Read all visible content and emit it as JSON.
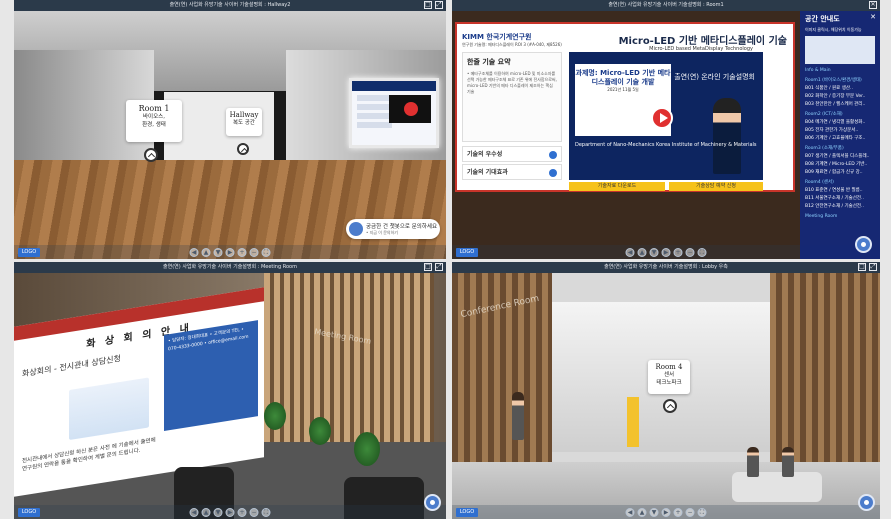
{
  "panes": {
    "hallway": {
      "title": "출연(연) 사업화 유망기술 사이버 기술설명회 : Hallway2",
      "room1": {
        "title": "Room 1",
        "lines": [
          "바이오스,",
          "환경, 생태"
        ]
      },
      "hallway": {
        "title": "Hallway",
        "line": "복도 공간"
      },
      "chat": {
        "main": "궁금한 건 챗봇으로 문의하세요",
        "sub": "• 지금 이 문의하기"
      },
      "logo": "LOGO"
    },
    "room1": {
      "title": "출연(연) 사업화 유망기술 사이버 기술설명회 : Room1",
      "org_logo": "KIMM 한국기계연구원",
      "org_info": "연구원 기술명: 메타디스플레이 ROI 3 (#A-040, 제8526)",
      "main_title": "Micro-LED 기반 메타디스플레이 기술",
      "sub_title": "Micro-LED based MetaDisplay Technology",
      "summary_head": "한줄 기술 요약",
      "summary_body": "• 메타구조체를 이용하여 micro-LED 및 미소소자를 선택 가능한 메타구조체 표로 기존 위에 전사함으로써, micro-LED 기반의 메타 디스플레이 제조하는 핵심 기술",
      "acc1": "기술의 우수성",
      "acc2": "기술의 기대효과",
      "video_box_title": "과제명: Micro-LED 기반 메타 디스플레이 기술 개발",
      "video_box_date": "2021년 11월 5일",
      "video_presenter": "출연(연) 온라인 기술설명회",
      "video_dept": "Department of Nano-Mechanics Korea Institute of Machinery & Materials",
      "btn_download": "기술자료 다운로드",
      "btn_consult": "기술상담 예약 신청",
      "panel": {
        "title": "공간 안내도",
        "loc": "이미지 클릭시, 해당위치 이동가능",
        "items": [
          {
            "text": "Info & Main",
            "main": true
          },
          {
            "text": "Room1 (바이오스/환경/생태)",
            "main": true
          },
          {
            "text": "B01 식품안 / 원료 생산..",
            "main": false
          },
          {
            "text": "B02 화학안 / 증기장 부문 Ver..",
            "main": false
          },
          {
            "text": "B03 천안한안 / 헬스케어 관리..",
            "main": false
          },
          {
            "text": "Room2 (ICT/소재)",
            "main": true
          },
          {
            "text": "B04 메가연 / 냉각열 을활성화..",
            "main": false
          },
          {
            "text": "B05 전자 관한가 가상문서..",
            "main": false
          },
          {
            "text": "B06 기계안 / 고효율메타 구조..",
            "main": false
          },
          {
            "text": "Room3 (소재/부품)",
            "main": true
          },
          {
            "text": "B07 생기연 / 플렉서블 디스플레..",
            "main": false
          },
          {
            "text": "B08 기계연 / Micro-LED 기반..",
            "main": false
          },
          {
            "text": "B09 재료연 / 합금가 신규 강..",
            "main": false
          },
          {
            "text": "Room4 (센서)",
            "main": true
          },
          {
            "text": "B10 표준연 / 연성물 반 필름..",
            "main": false
          },
          {
            "text": "B11 서울연구소재 / 기술선전..",
            "main": false
          },
          {
            "text": "B12 안전연구소재 / 기술선전..",
            "main": false
          },
          {
            "text": "Meeting Room",
            "main": true
          }
        ]
      }
    },
    "meeting": {
      "title": "출연(연) 사업화 유망기술 사이버 기술설명회 : Meeting Room",
      "screen_title": "화 상 회 의 안 내",
      "screen_left": "화상회의 - 전시관내 상담신청",
      "screen_bottom": "전시관내에서 상담신청 하신 분은 사전 에 기술에서 출연에 연구원의 연락을 통을 확인하여 계별 문의 드립니다.",
      "screen_blue": "• 담당자: 정대희대표 • 고객문의 TEL • 070-4333-0000 • office@email.com",
      "wall_text": "Meeting Room",
      "logo": "LOGO"
    },
    "lobby": {
      "title": "출연(연) 사업화 유망기술 사이버 기술설명회 : Lobby 우측",
      "room4": {
        "title": "Room 4",
        "lines": [
          "센서",
          "테크노파크"
        ]
      },
      "wall_text": "Conference Room",
      "logo": "LOGO"
    }
  },
  "nav_buttons": [
    "◀",
    "▲",
    "▼",
    "▶",
    "+",
    "−",
    "⛶"
  ]
}
